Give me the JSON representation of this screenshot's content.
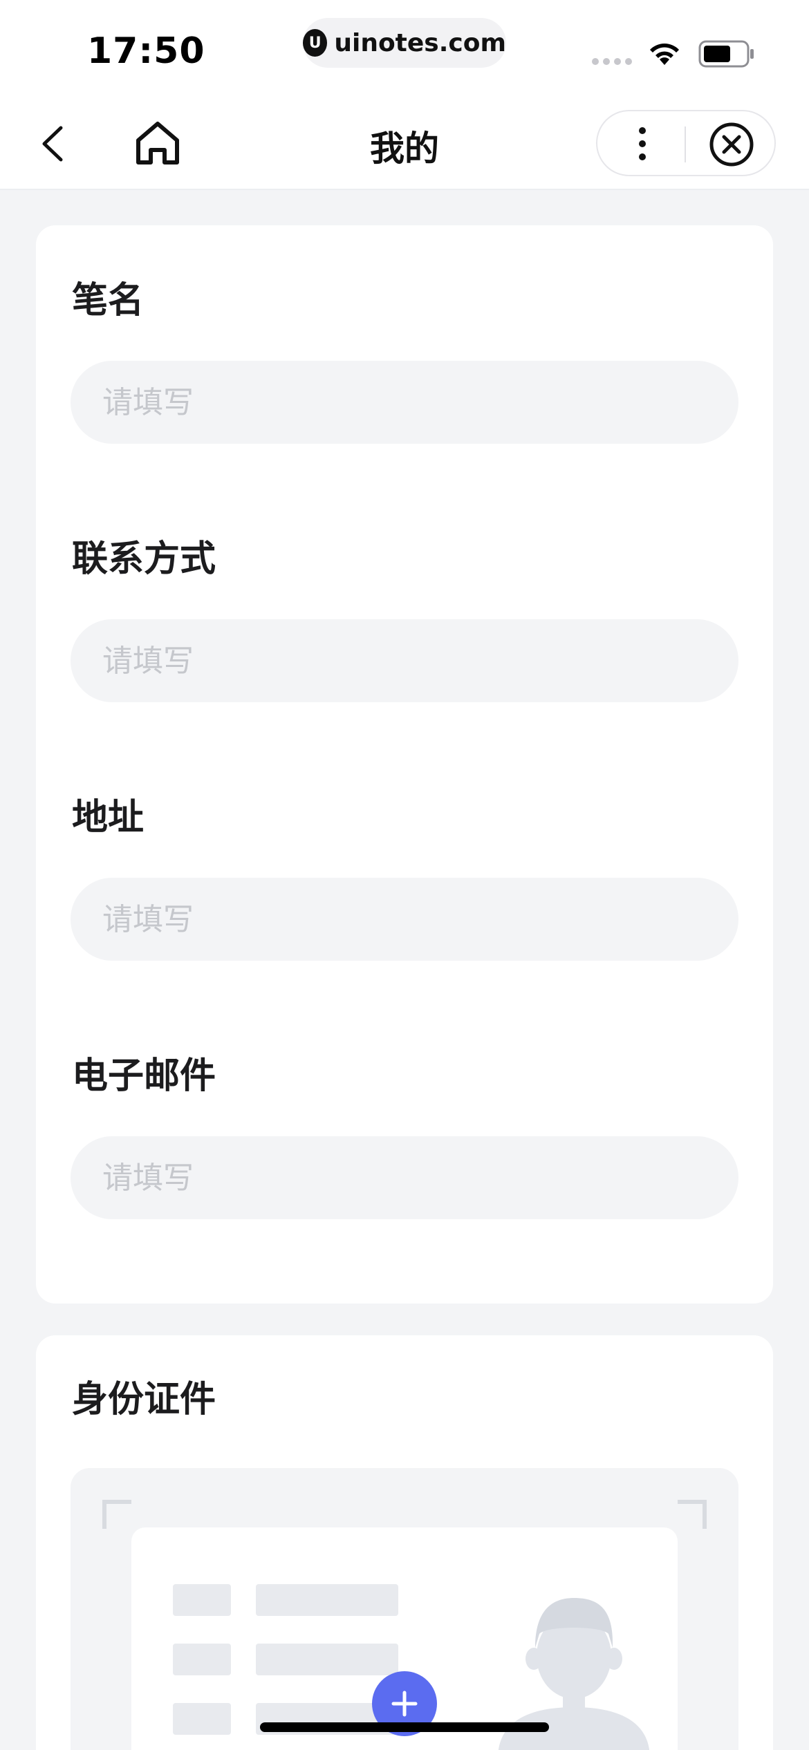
{
  "status_bar": {
    "time": "17:50",
    "url": "uinotes.com",
    "logo_letter": "U"
  },
  "nav": {
    "title": "我的"
  },
  "form": {
    "fields": [
      {
        "label": "笔名",
        "placeholder": "请填写",
        "value": ""
      },
      {
        "label": "联系方式",
        "placeholder": "请填写",
        "value": ""
      },
      {
        "label": "地址",
        "placeholder": "请填写",
        "value": ""
      },
      {
        "label": "电子邮件",
        "placeholder": "请填写",
        "value": ""
      }
    ]
  },
  "id_section": {
    "label": "身份证件"
  },
  "colors": {
    "accent": "#5b6cf0",
    "page_background": "#f3f4f6",
    "input_background": "#f3f4f6",
    "placeholder": "#c5c7cc"
  },
  "icons": {
    "back": "chevron-left-icon",
    "home": "home-icon",
    "more": "more-vertical-icon",
    "close": "close-circle-icon",
    "add": "plus-icon",
    "wifi": "wifi-icon",
    "battery": "battery-icon"
  }
}
